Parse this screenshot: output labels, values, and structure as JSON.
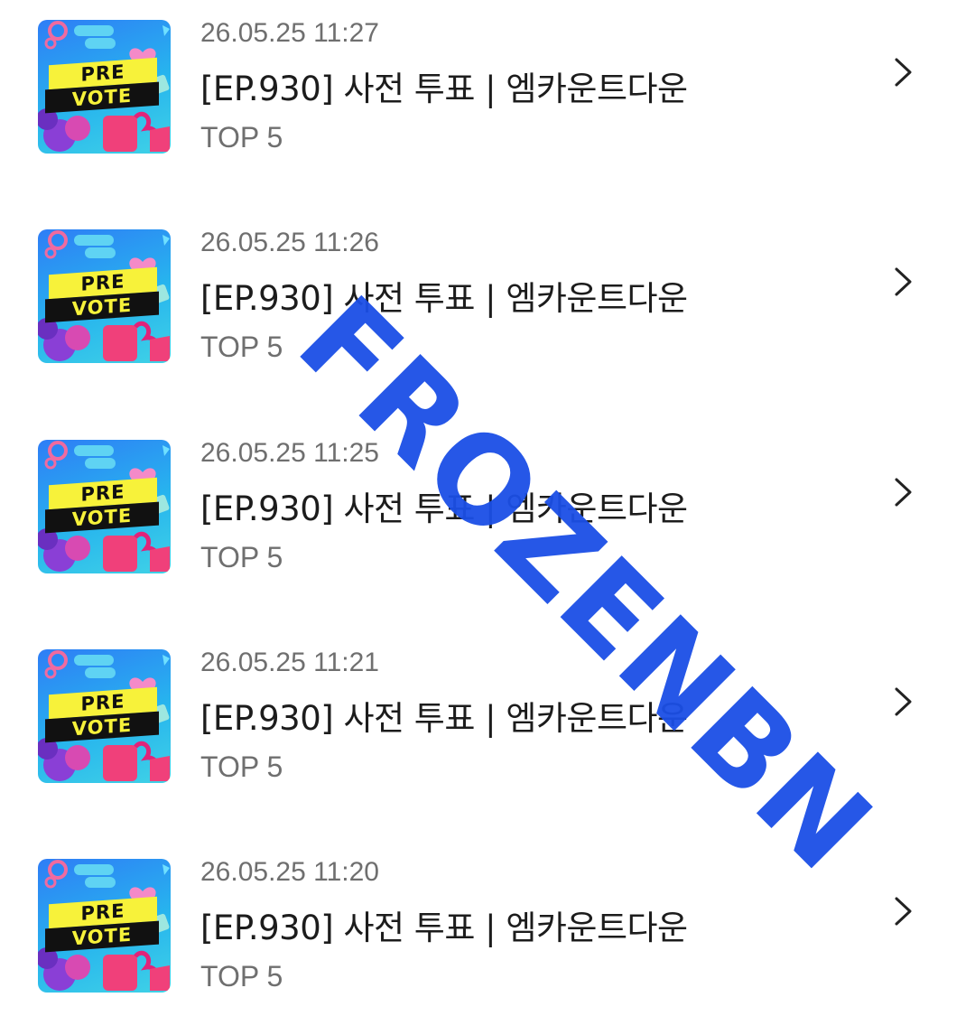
{
  "items": [
    {
      "date": "26.05.25 11:27",
      "title": "[EP.930] 사전 투표 | 엠카운트다운",
      "subtitle": "TOP 5",
      "thumb_top": "PRE",
      "thumb_bottom": "VOTE"
    },
    {
      "date": "26.05.25 11:26",
      "title": "[EP.930] 사전 투표 | 엠카운트다운",
      "subtitle": "TOP 5",
      "thumb_top": "PRE",
      "thumb_bottom": "VOTE"
    },
    {
      "date": "26.05.25 11:25",
      "title": "[EP.930] 사전 투표 | 엠카운트다운",
      "subtitle": "TOP 5",
      "thumb_top": "PRE",
      "thumb_bottom": "VOTE"
    },
    {
      "date": "26.05.25 11:21",
      "title": "[EP.930] 사전 투표 | 엠카운트다운",
      "subtitle": "TOP 5",
      "thumb_top": "PRE",
      "thumb_bottom": "VOTE"
    },
    {
      "date": "26.05.25 11:20",
      "title": "[EP.930] 사전 투표 | 엠카운트다운",
      "subtitle": "TOP 5",
      "thumb_top": "PRE",
      "thumb_bottom": "VOTE"
    }
  ],
  "watermark": "FROZENBN",
  "icons": {
    "row_action": "chevron-right-icon"
  },
  "colors": {
    "watermark": "#1b4fe6",
    "thumb_bg": "#27b4ee",
    "thumb_yellow": "#f7f23a",
    "thumb_pink": "#f0407a"
  }
}
